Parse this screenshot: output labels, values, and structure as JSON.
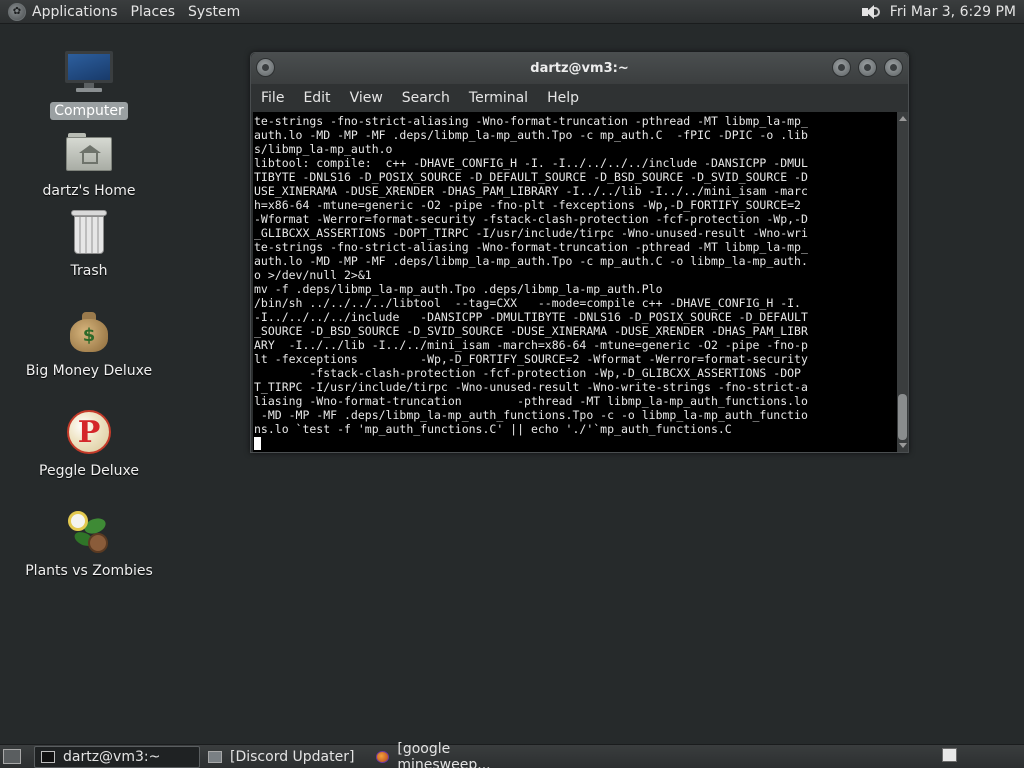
{
  "top_panel": {
    "menus": [
      "Applications",
      "Places",
      "System"
    ],
    "clock": "Fri Mar  3,  6:29 PM"
  },
  "desktop": {
    "icons": [
      {
        "label": "Computer",
        "icon": "computer-icon",
        "selected": true
      },
      {
        "label": "dartz's Home",
        "icon": "home-folder-icon"
      },
      {
        "label": "Trash",
        "icon": "trash-icon"
      },
      {
        "label": "Big Money Deluxe",
        "icon": "money-bag-icon"
      },
      {
        "label": "Peggle Deluxe",
        "icon": "peggle-icon"
      },
      {
        "label": "Plants vs Zombies",
        "icon": "plants-vs-zombies-icon"
      }
    ]
  },
  "terminal": {
    "title": "dartz@vm3:~",
    "menu": [
      "File",
      "Edit",
      "View",
      "Search",
      "Terminal",
      "Help"
    ],
    "lines": [
      "te-strings -fno-strict-aliasing -Wno-format-truncation -pthread -MT libmp_la-mp_",
      "auth.lo -MD -MP -MF .deps/libmp_la-mp_auth.Tpo -c mp_auth.C  -fPIC -DPIC -o .lib",
      "s/libmp_la-mp_auth.o",
      "libtool: compile:  c++ -DHAVE_CONFIG_H -I. -I../../../../include -DANSICPP -DMUL",
      "TIBYTE -DNLS16 -D_POSIX_SOURCE -D_DEFAULT_SOURCE -D_BSD_SOURCE -D_SVID_SOURCE -D",
      "USE_XINERAMA -DUSE_XRENDER -DHAS_PAM_LIBRARY -I../../lib -I../../mini_isam -marc",
      "h=x86-64 -mtune=generic -O2 -pipe -fno-plt -fexceptions -Wp,-D_FORTIFY_SOURCE=2",
      "-Wformat -Werror=format-security -fstack-clash-protection -fcf-protection -Wp,-D",
      "_GLIBCXX_ASSERTIONS -DOPT_TIRPC -I/usr/include/tirpc -Wno-unused-result -Wno-wri",
      "te-strings -fno-strict-aliasing -Wno-format-truncation -pthread -MT libmp_la-mp_",
      "auth.lo -MD -MP -MF .deps/libmp_la-mp_auth.Tpo -c mp_auth.C -o libmp_la-mp_auth.",
      "o >/dev/null 2>&1",
      "mv -f .deps/libmp_la-mp_auth.Tpo .deps/libmp_la-mp_auth.Plo",
      "/bin/sh ../../../../libtool  --tag=CXX   --mode=compile c++ -DHAVE_CONFIG_H -I.",
      "-I../../../../include   -DANSICPP -DMULTIBYTE -DNLS16 -D_POSIX_SOURCE -D_DEFAULT",
      "_SOURCE -D_BSD_SOURCE -D_SVID_SOURCE -DUSE_XINERAMA -DUSE_XRENDER -DHAS_PAM_LIBR",
      "ARY  -I../../lib -I../../mini_isam -march=x86-64 -mtune=generic -O2 -pipe -fno-p",
      "lt -fexceptions         -Wp,-D_FORTIFY_SOURCE=2 -Wformat -Werror=format-security",
      "        -fstack-clash-protection -fcf-protection -Wp,-D_GLIBCXX_ASSERTIONS -DOP",
      "T_TIRPC -I/usr/include/tirpc -Wno-unused-result -Wno-write-strings -fno-strict-a",
      "liasing -Wno-format-truncation        -pthread -MT libmp_la-mp_auth_functions.lo",
      " -MD -MP -MF .deps/libmp_la-mp_auth_functions.Tpo -c -o libmp_la-mp_auth_functio",
      "ns.lo `test -f 'mp_auth_functions.C' || echo './'`mp_auth_functions.C",
      ""
    ]
  },
  "taskbar": {
    "tasks": [
      {
        "label": "dartz@vm3:~",
        "icon": "terminal-icon",
        "active": true
      },
      {
        "label": "[Discord Updater]",
        "icon": "window-icon",
        "active": false
      },
      {
        "label": "[google minesweep...",
        "icon": "firefox-icon",
        "active": false
      }
    ]
  }
}
